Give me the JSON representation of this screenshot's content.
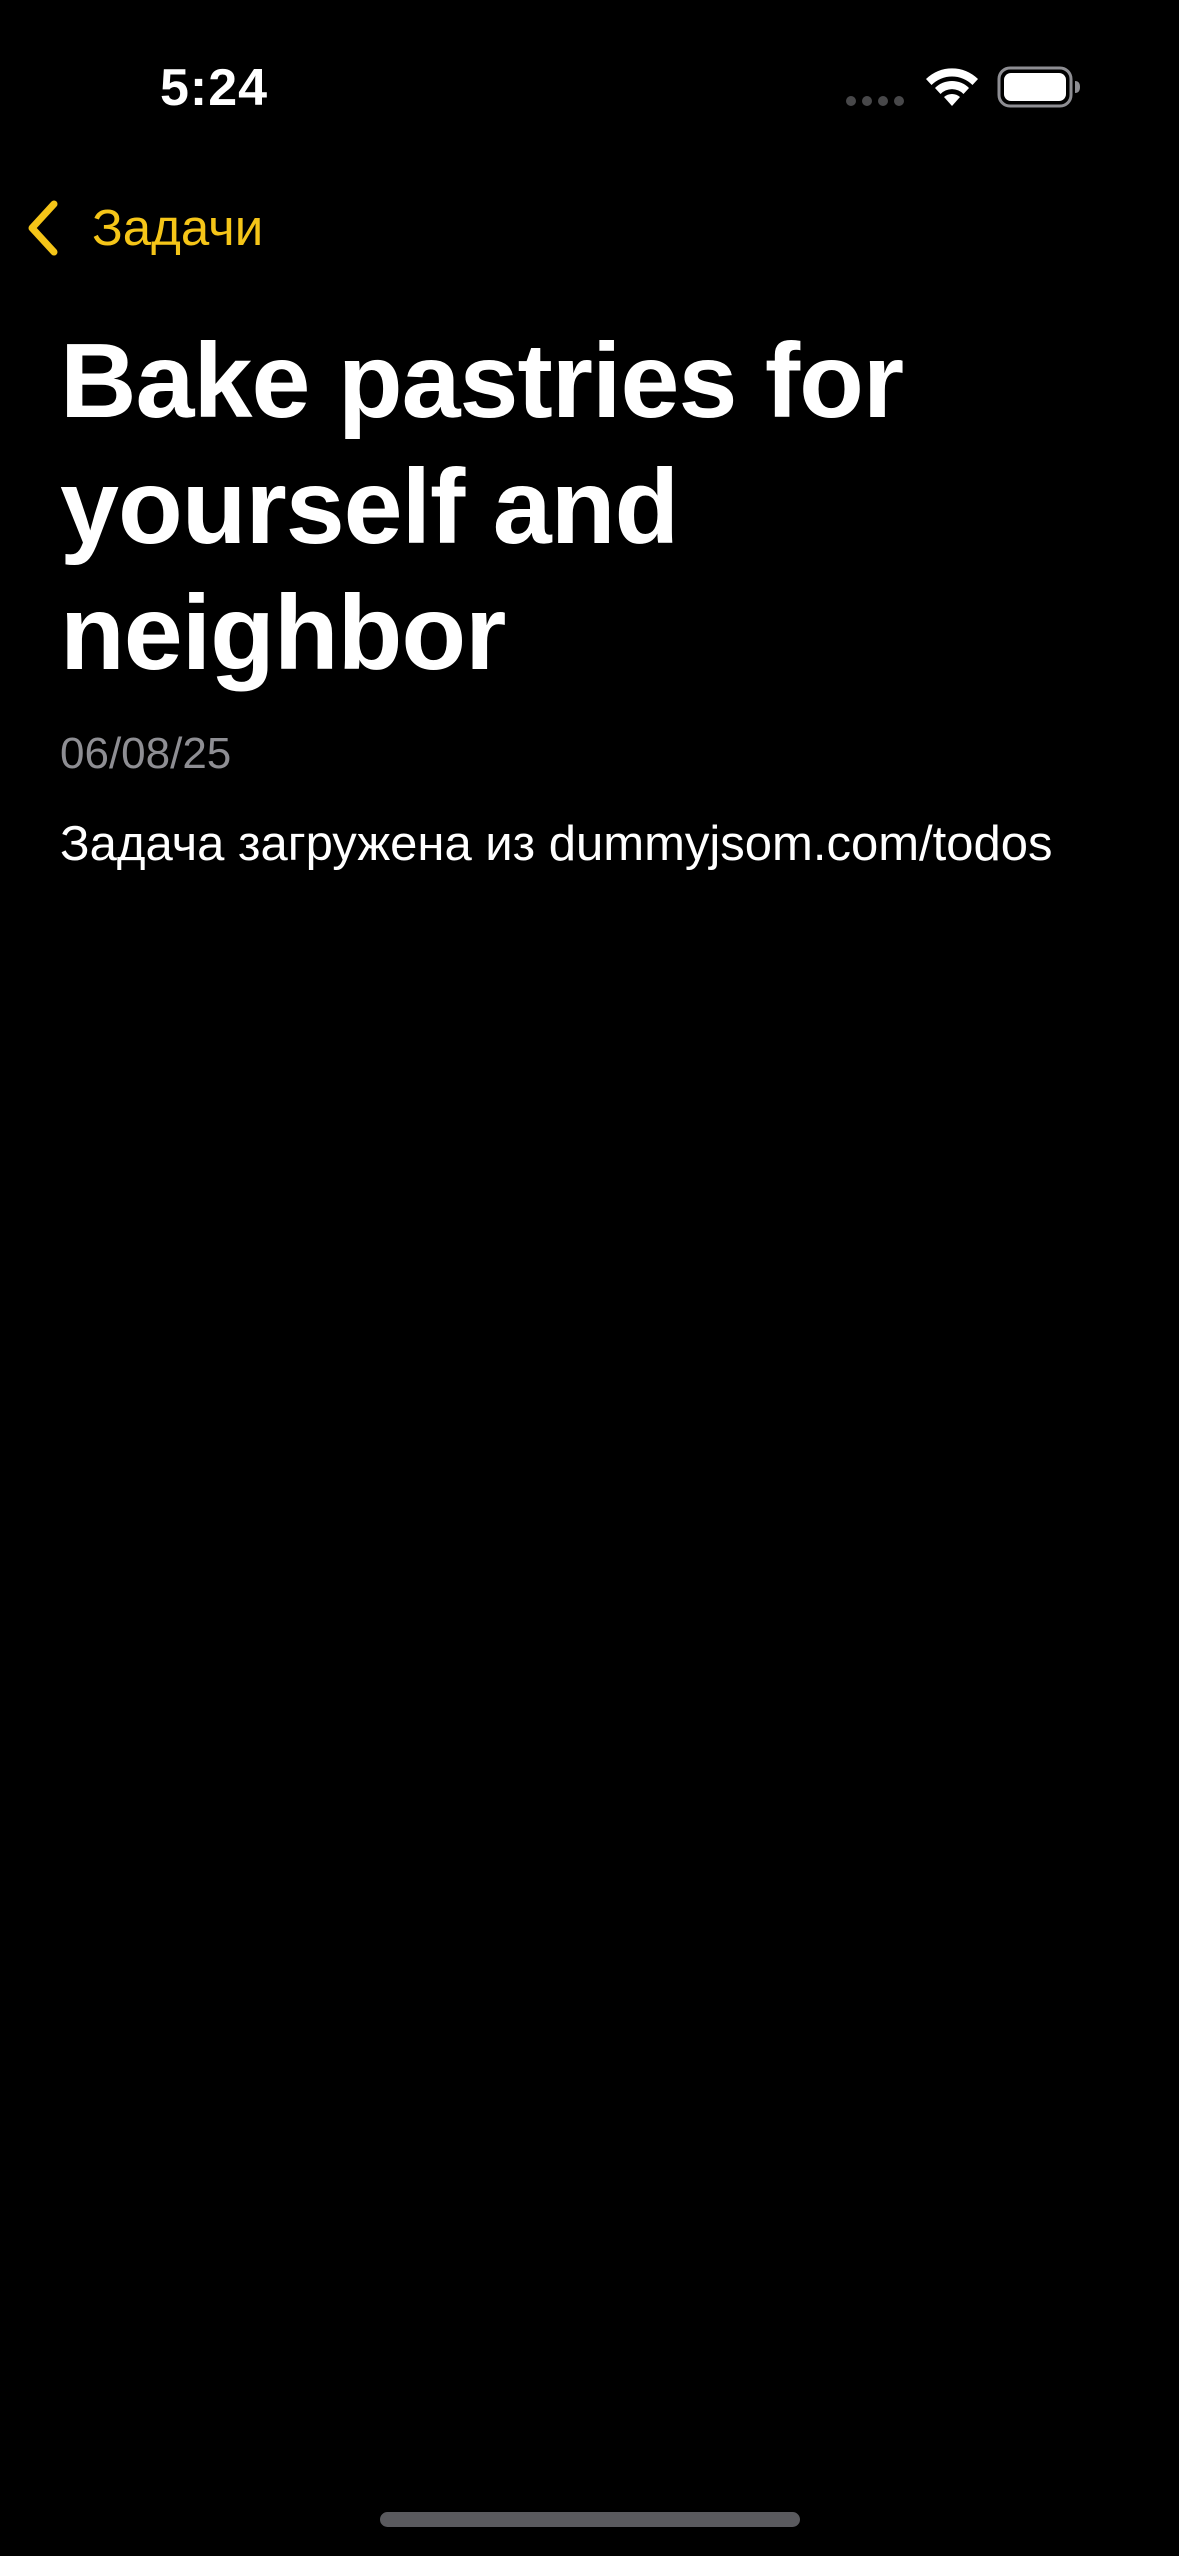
{
  "status_bar": {
    "time": "5:24",
    "icons": [
      "cellular-signal-icon",
      "wifi-icon",
      "battery-icon"
    ]
  },
  "nav": {
    "back_label": "Задачи",
    "back_icon": "chevron-left-icon"
  },
  "task": {
    "title": "Bake pastries for yourself and neighbor",
    "date": "06/08/25",
    "description": "Задача загружена из dummyjsom.com/todos"
  },
  "colors": {
    "background": "#000000",
    "accent": "#f5c518",
    "secondary_text": "#8e8e93",
    "primary_text": "#ffffff"
  }
}
